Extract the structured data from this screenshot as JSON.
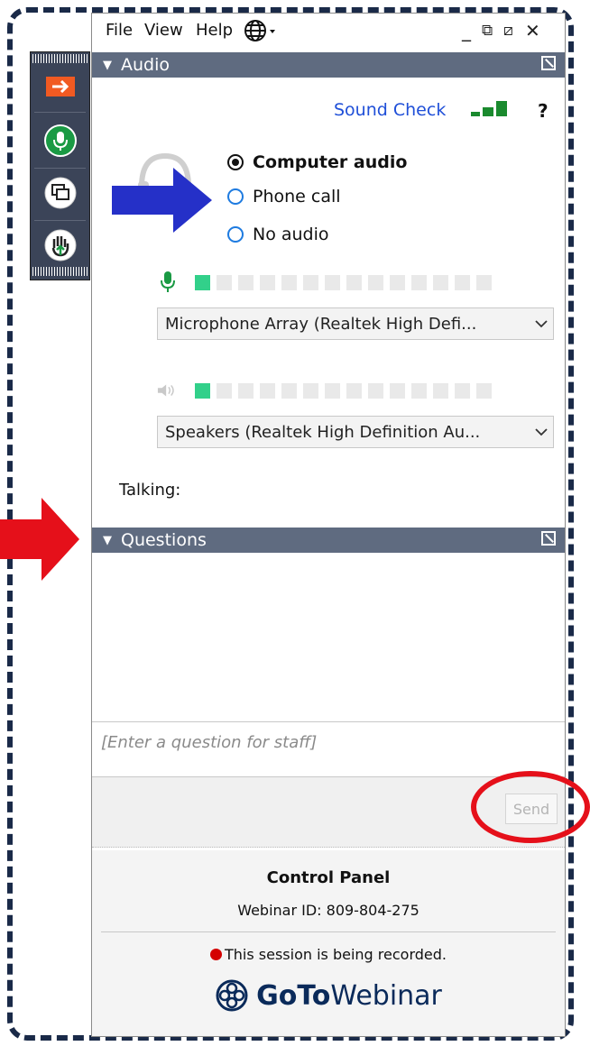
{
  "menubar": {
    "items": [
      "File",
      "View",
      "Help"
    ],
    "globe_icon": "globe-icon"
  },
  "audio": {
    "header": "Audio",
    "sound_check": "Sound Check",
    "help": "?",
    "options": [
      {
        "label": "Computer audio",
        "selected": true
      },
      {
        "label": "Phone call",
        "selected": false
      },
      {
        "label": "No audio",
        "selected": false
      }
    ],
    "mic_device": "Microphone Array (Realtek High Defi...",
    "speaker_device": "Speakers (Realtek High Definition Au...",
    "talking_label": "Talking:"
  },
  "questions": {
    "header": "Questions",
    "placeholder": "[Enter a question for staff]",
    "send_label": "Send"
  },
  "footer": {
    "title": "Control Panel",
    "webinar_id": "Webinar ID: 809-804-275",
    "recording": "This session is being recorded.",
    "logo_goto": "GoTo",
    "logo_webinar": "Webinar"
  },
  "colors": {
    "header_bg": "#5f6b80",
    "toolbar_bg": "#3b4458",
    "link": "#1f4fd8",
    "level_on": "#32d08a",
    "annotation_blue": "#2530c8",
    "annotation_red": "#e5101a"
  }
}
